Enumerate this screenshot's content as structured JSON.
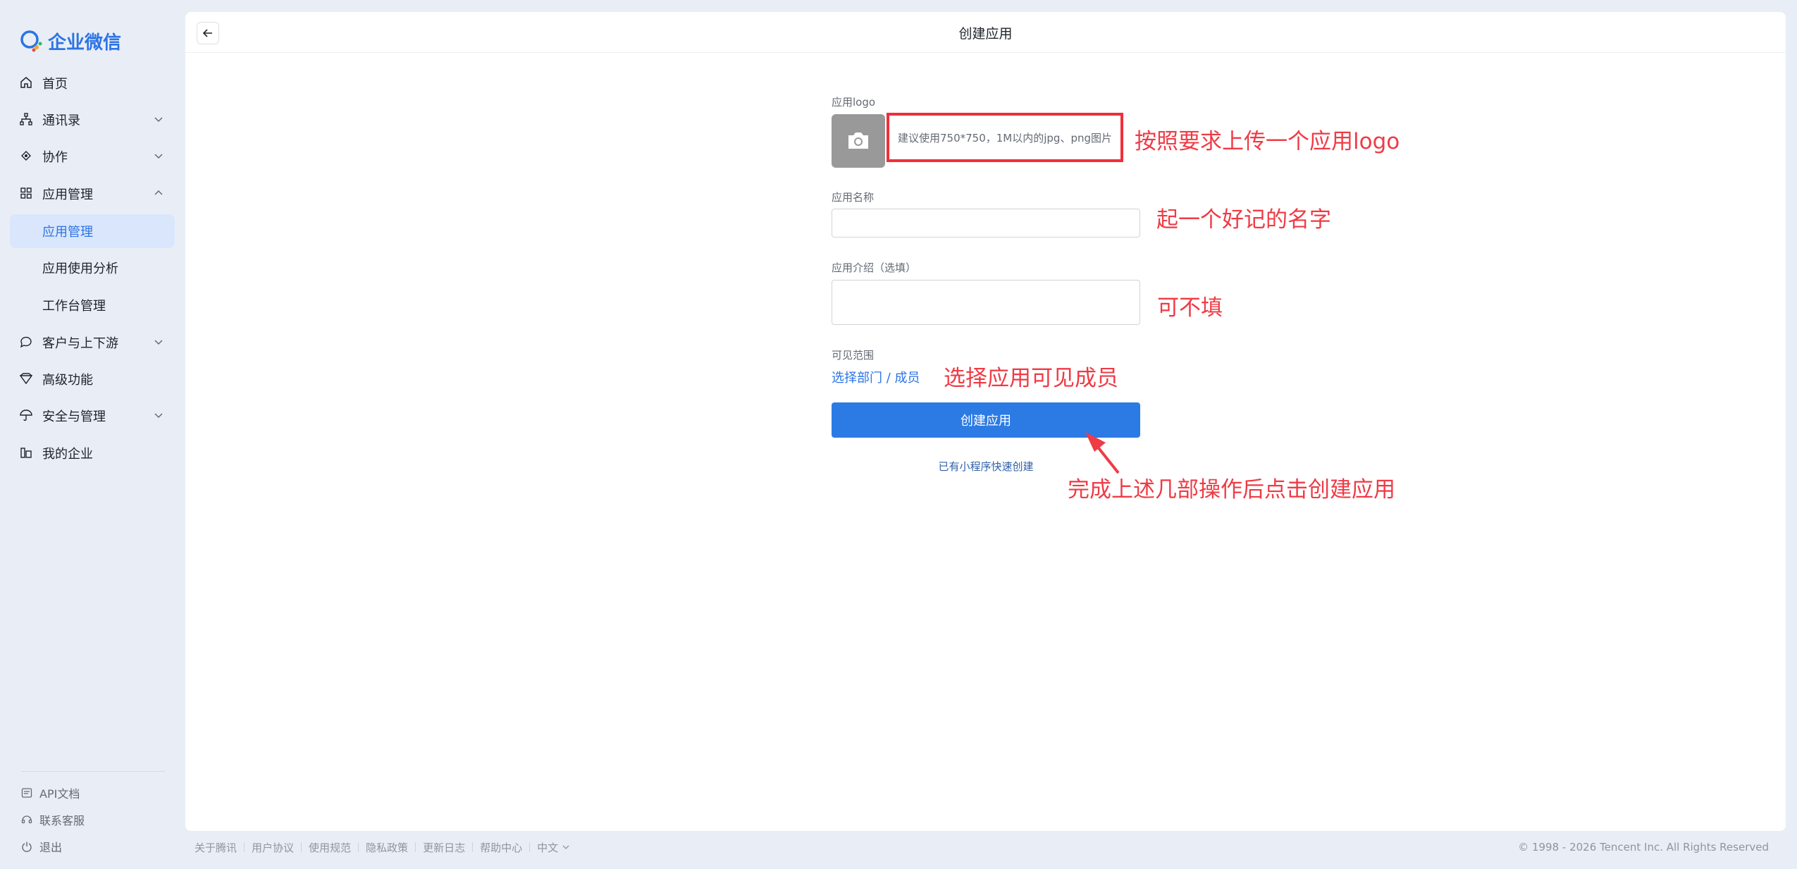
{
  "brand": {
    "name": "企业微信",
    "accent": "#2c74e6"
  },
  "sidebar": {
    "items": [
      {
        "label": "首页",
        "icon": "home-icon"
      },
      {
        "label": "通讯录",
        "icon": "org-tree-icon"
      },
      {
        "label": "协作",
        "icon": "collab-icon"
      },
      {
        "label": "应用管理",
        "icon": "apps-grid-icon"
      },
      {
        "label": "应用管理"
      },
      {
        "label": "应用使用分析"
      },
      {
        "label": "工作台管理"
      },
      {
        "label": "客户与上下游",
        "icon": "chat-bubble-icon"
      },
      {
        "label": "高级功能",
        "icon": "diamond-icon"
      },
      {
        "label": "安全与管理",
        "icon": "umbrella-icon"
      },
      {
        "label": "我的企业",
        "icon": "building-icon"
      }
    ],
    "bottom": [
      {
        "label": "API文档",
        "icon": "api-doc-icon"
      },
      {
        "label": "联系客服",
        "icon": "support-icon"
      },
      {
        "label": "退出",
        "icon": "power-icon"
      }
    ]
  },
  "header": {
    "title": "创建应用"
  },
  "form": {
    "logo_label": "应用logo",
    "logo_hint": "建议使用750*750，1M以内的jpg、png图片",
    "name_label": "应用名称",
    "name_value": "",
    "intro_label": "应用介绍（选填）",
    "intro_value": "",
    "scope_label": "可见范围",
    "scope_link": "选择部门 / 成员",
    "submit_label": "创建应用",
    "mini_program_link": "已有小程序快速创建"
  },
  "annotations": {
    "logo": "按照要求上传一个应用logo",
    "name": "起一个好记的名字",
    "intro": "可不填",
    "scope": "选择应用可见成员",
    "submit": "完成上述几部操作后点击创建应用",
    "color": "#ef3b45"
  },
  "footer": {
    "links": [
      "关于腾讯",
      "用户协议",
      "使用规范",
      "隐私政策",
      "更新日志",
      "帮助中心",
      "中文"
    ],
    "copyright": "© 1998 - 2026 Tencent Inc. All Rights Reserved"
  }
}
